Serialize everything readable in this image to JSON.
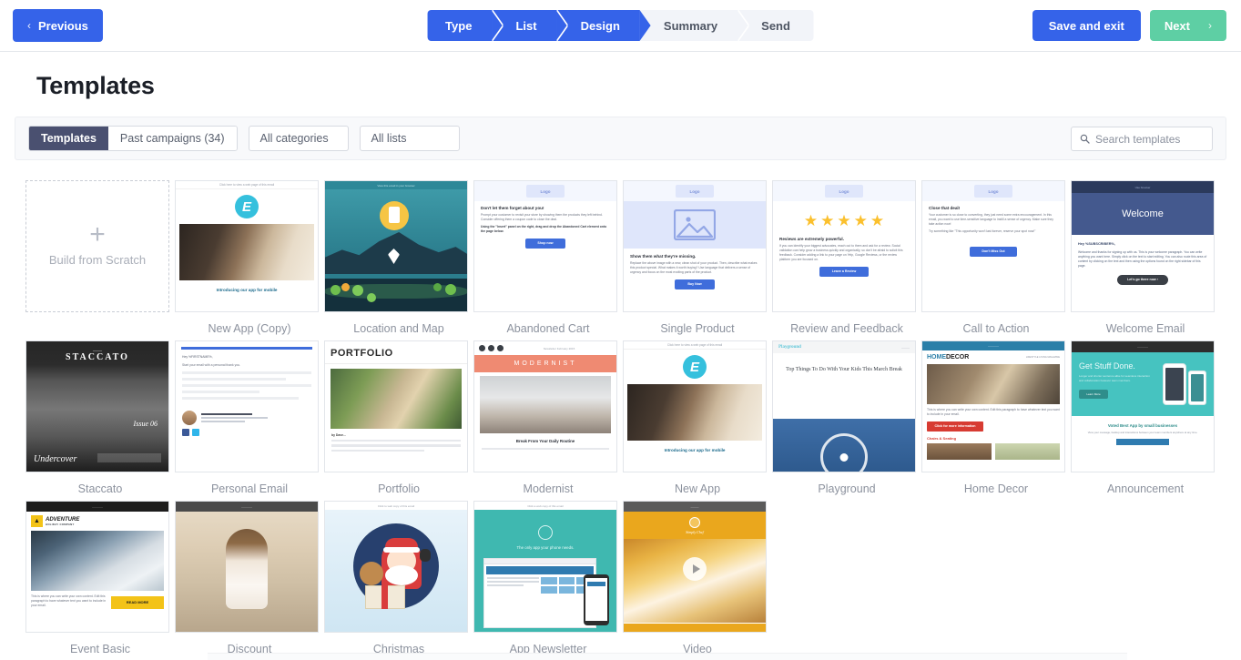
{
  "topbar": {
    "previous_label": "Previous",
    "previous_chevron": "‹",
    "save_label": "Save and exit",
    "next_label": "Next",
    "next_chevron": "›",
    "colors": {
      "primary": "#3563e9",
      "next": "#5ecfa4",
      "step_inactive_bg": "#f2f4f9"
    },
    "steps": [
      {
        "label": "Type",
        "state": "active"
      },
      {
        "label": "List",
        "state": "active"
      },
      {
        "label": "Design",
        "state": "active"
      },
      {
        "label": "Summary",
        "state": "inactive"
      },
      {
        "label": "Send",
        "state": "inactive"
      }
    ]
  },
  "page": {
    "title": "Templates"
  },
  "filters": {
    "segments": [
      {
        "label": "Templates",
        "selected": true
      },
      {
        "label": "Past campaigns (34)",
        "selected": false
      }
    ],
    "dropdowns": [
      {
        "label": "All categories"
      },
      {
        "label": "All lists"
      }
    ],
    "search": {
      "placeholder": "Search templates",
      "icon": "search-icon",
      "value": ""
    }
  },
  "scratch": {
    "label": "Build from Scratch",
    "icon": "plus-icon"
  },
  "templates": [
    {
      "name": "New App (Copy)",
      "art": "newapp",
      "preheader": "Click here to view a web page of this email",
      "headline": "Introducing our app for mobile"
    },
    {
      "name": "Location and Map",
      "art": "location",
      "preheader": "View this email in your browser"
    },
    {
      "name": "Abandoned Cart",
      "art": "wire",
      "logo": "Logo",
      "heading": "Don't let them forget about you!",
      "body": "Prompt your customer to revisit your store by showing them the products they left behind. Consider offering them a coupon code to close the deal.",
      "body2": "Using the \"Insert\" panel on the right, drag and drop the Abandoned Cart element onto the page below.",
      "cta": "Shop now"
    },
    {
      "name": "Single Product",
      "art": "product",
      "logo": "Logo",
      "heading": "Show them what they're missing.",
      "body": "Replace the above image with a new, clean shot of your product. Then, describe what makes this product special. What makes it worth buying? Use language that delivers a sense of urgency and focus on the most exciting parts of the product.",
      "cta": "Buy Now"
    },
    {
      "name": "Review and Feedback",
      "art": "review",
      "logo": "Logo",
      "heading": "Reviews are extremely powerful.",
      "body": "If you can identify your biggest advocates, reach out to them and ask for a review. Social validation can help grow a business quickly and organically, so don't be afraid to solicit this feedback. Consider adding a link to your page on Yelp, Google Reviews, or the review platform you are focused on.",
      "cta": "Leave a Review",
      "stars": 5
    },
    {
      "name": "Call to Action",
      "art": "cta",
      "logo": "Logo",
      "heading": "Close that deal!",
      "body": "Your customer is so close to converting, they just need some extra encouragement. In this email, you want to use time-sensitive language to instill a sense of urgency. Make sure they take action now!",
      "body2": "Try something like \"This opportunity won't last forever, reserve your spot now!\"",
      "cta": "Don't Miss Out"
    },
    {
      "name": "Welcome Email",
      "art": "welcome",
      "preheader": "Use browser",
      "hero": "Welcome",
      "greeting": "Hey %SUBSCRIBER%,",
      "body": "Welcome and thanks for signing up with us. This is your welcome paragraph. You can write anything you want here. Simply click on the text to start editing. You can also route this area of content by clicking on the text and then using the options found on the right sidebar of this page.",
      "cta": "Let's go there now ›"
    },
    {
      "name": "Staccato",
      "art": "staccato",
      "brand": "STACCATO",
      "issue": "Issue 06",
      "caption": "Undercover"
    },
    {
      "name": "Personal Email",
      "art": "personal",
      "greeting": "Hey %FIRSTNAME%,",
      "body": "Start your email with a personal thank you."
    },
    {
      "name": "Portfolio",
      "art": "portfolio",
      "brand": "PORTFOLIO",
      "byline": "by Dave..."
    },
    {
      "name": "Modernist",
      "art": "modernist",
      "brand": "MODERNIST",
      "preheader": "Newsletter February 2015",
      "caption": "Break From Your Daily Routine"
    },
    {
      "name": "New App",
      "art": "newapp",
      "preheader": "Click here to view a web page of this email",
      "headline": "Introducing our app for mobile"
    },
    {
      "name": "Playground",
      "art": "playground",
      "brand": "Playground",
      "headline": "Top Things To Do With Your Kids This March Break"
    },
    {
      "name": "Home Decor",
      "art": "homedecor",
      "brand": "HOMEDECOR",
      "tagline": "LIFESTYLE LIVING MAGAZINE",
      "cta": "Click for more information",
      "section": "Chairs & Seating"
    },
    {
      "name": "Announcement",
      "art": "announce",
      "hero": "Get Stuff Done.",
      "cta": "Learn More",
      "footline": "Voted Best App by small businesses"
    },
    {
      "name": "Event Basic",
      "art": "event",
      "brand": "ADVENTURE",
      "brand2": "HOLIDAY COMPANY",
      "cta": "READ MORE"
    },
    {
      "name": "Discount",
      "art": "discount"
    },
    {
      "name": "Christmas",
      "art": "christmas"
    },
    {
      "name": "App Newsletter",
      "art": "appnews",
      "headline": "The only app your phone needs."
    },
    {
      "name": "Video",
      "art": "video",
      "icon": "play-icon"
    }
  ]
}
